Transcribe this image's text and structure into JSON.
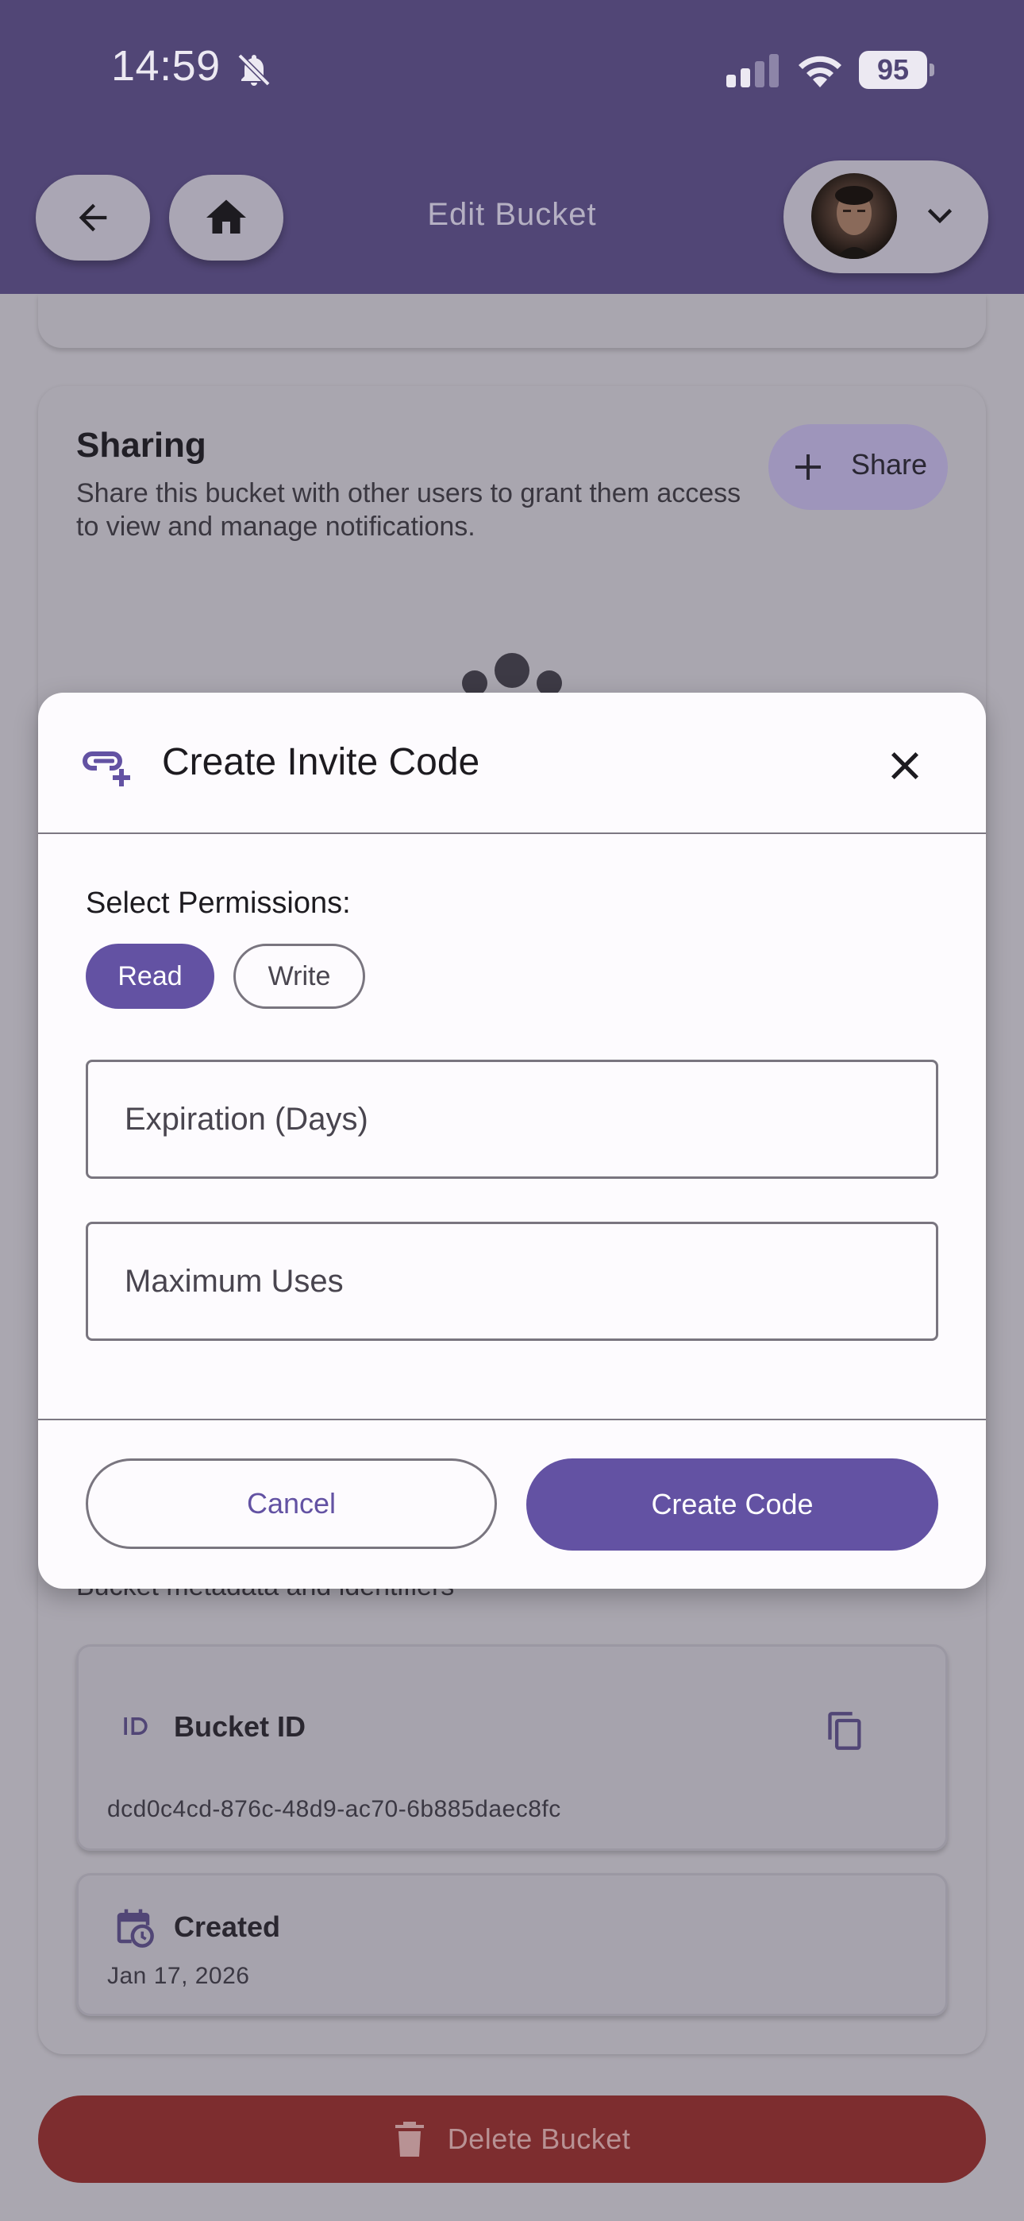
{
  "status_bar": {
    "time": "14:59",
    "battery": "95",
    "icons": [
      "bell-muted-icon",
      "signal-icon",
      "wifi-icon",
      "battery-icon"
    ]
  },
  "app_bar": {
    "title": "Edit Bucket",
    "icons": [
      "back-arrow-icon",
      "home-icon",
      "chevron-down-icon"
    ]
  },
  "sharing": {
    "title": "Sharing",
    "description": "Share this bucket with other users to grant them access to view and manage notifications.",
    "share_label": "Share"
  },
  "metadata": {
    "description": "Bucket metadata and identifiers",
    "bucket_id_label": "Bucket ID",
    "bucket_id_value": "dcd0c4cd-876c-48d9-ac70-6b885daec8fc",
    "created_label": "Created",
    "created_value": "Jan 17, 2026"
  },
  "delete_label": "Delete Bucket",
  "dialog": {
    "title": "Create Invite Code",
    "permissions_label": "Select Permissions:",
    "chips": [
      {
        "label": "Read",
        "selected": true
      },
      {
        "label": "Write",
        "selected": false
      }
    ],
    "expiration_placeholder": "Expiration (Days)",
    "max_uses_placeholder": "Maximum Uses",
    "cancel_label": "Cancel",
    "create_label": "Create Code"
  },
  "colors": {
    "primary": "#6352a3",
    "app_bar": "#514676",
    "danger": "#7d2d2f",
    "scrim_background": "#aaa7b0"
  }
}
